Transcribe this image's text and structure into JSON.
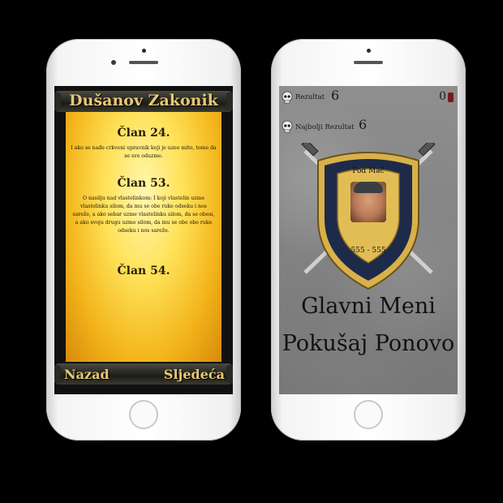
{
  "left_screen": {
    "title": "Dušanov Zakonik",
    "articles": [
      {
        "heading": "Član 24.",
        "text": "I ako se nađe crkveni upravnik koji je uzeo mito, tome da se sve oduzme."
      },
      {
        "heading": "Član 53.",
        "text": "O nasilju nad vlastelinkom: I koji vlastelin uzme vlastelinku silom, da mu se obe ruke odseku i nos sareže, a ako sebar uzme vlastelinku silom, da se obesi, a ako svoju drugu uzme silom, da mu se obe obe ruke odseku i nos sareže."
      },
      {
        "heading": "Član 54.",
        "text": ""
      }
    ],
    "back_label": "Nazad",
    "next_label": "Sljedeća"
  },
  "right_screen": {
    "score_label": "Rezultat",
    "score_value": "6",
    "best_label": "Najbolji Rezultat",
    "best_value": "6",
    "corner_value": "0",
    "shield_top": "Pod Mač",
    "shield_bottom": "555 - 555",
    "main_menu_label": "Glavni Meni",
    "retry_label": "Pokušaj Ponovo"
  },
  "icons": [
    "skull-icon",
    "sword-icon",
    "shield-icon",
    "portrait-photo"
  ],
  "colors": {
    "scroll_gold": "#f3b51b",
    "stone_gray": "#8a8a8a",
    "shield_blue": "#1e2a4a",
    "shield_gold": "#d8b14a"
  }
}
